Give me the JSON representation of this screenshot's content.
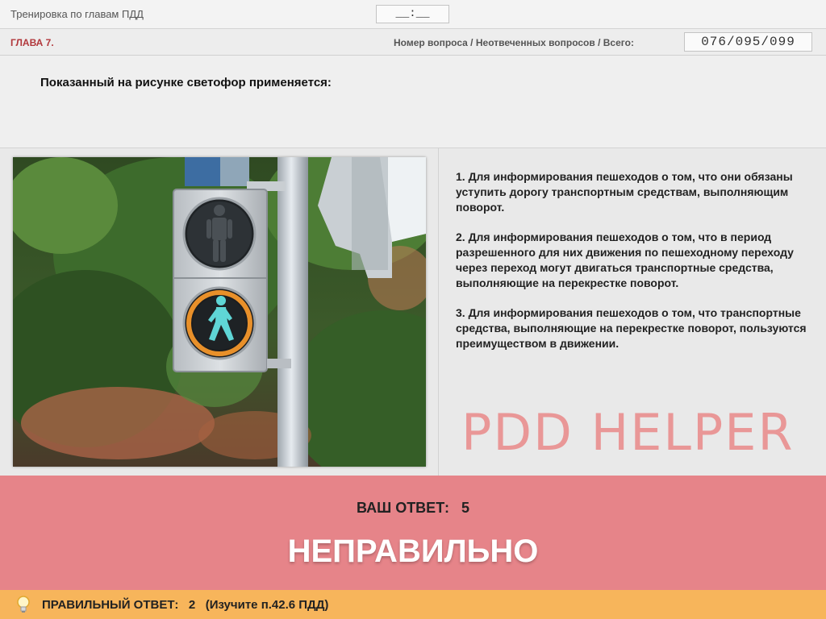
{
  "header": {
    "title": "Тренировка по главам ПДД",
    "timer": "__:__"
  },
  "chapter": {
    "label": "ГЛАВА 7.",
    "counter_label": "Номер вопроса / Неотвеченных вопросов / Всего:",
    "counter_value": "076/095/099"
  },
  "question": {
    "text": "Показанный на рисунке светофор применяется:"
  },
  "answers": [
    "1.  Для информирования пешеходов о том, что они обязаны уступить дорогу транспортным средствам, выполняющим поворот.",
    "2.  Для информирования пешеходов о том, что в период разрешенного для них движения по пешеходному переходу через переход могут двигаться транспортные средства, выполняющие на перекрестке поворот.",
    "3.  Для информирования пешеходов о том, что транспортные средства, выполняющие на перекрестке поворот, пользуются преимуществом в движении."
  ],
  "watermark": "PDD HELPER",
  "result": {
    "your_answer_label": "ВАШ  ОТВЕТ:",
    "your_answer_value": "5",
    "verdict": "НЕПРАВИЛЬНО",
    "color": "#e68489"
  },
  "correct": {
    "label": "ПРАВИЛЬНЫЙ ОТВЕТ:",
    "value": "2",
    "hint": "(Изучите п.42.6 ПДД)",
    "color": "#f7b55b"
  },
  "colors": {
    "chapter": "#b1373b",
    "pedestrian_go": "#5fd6d6",
    "signal_ring": "#e8902a"
  }
}
